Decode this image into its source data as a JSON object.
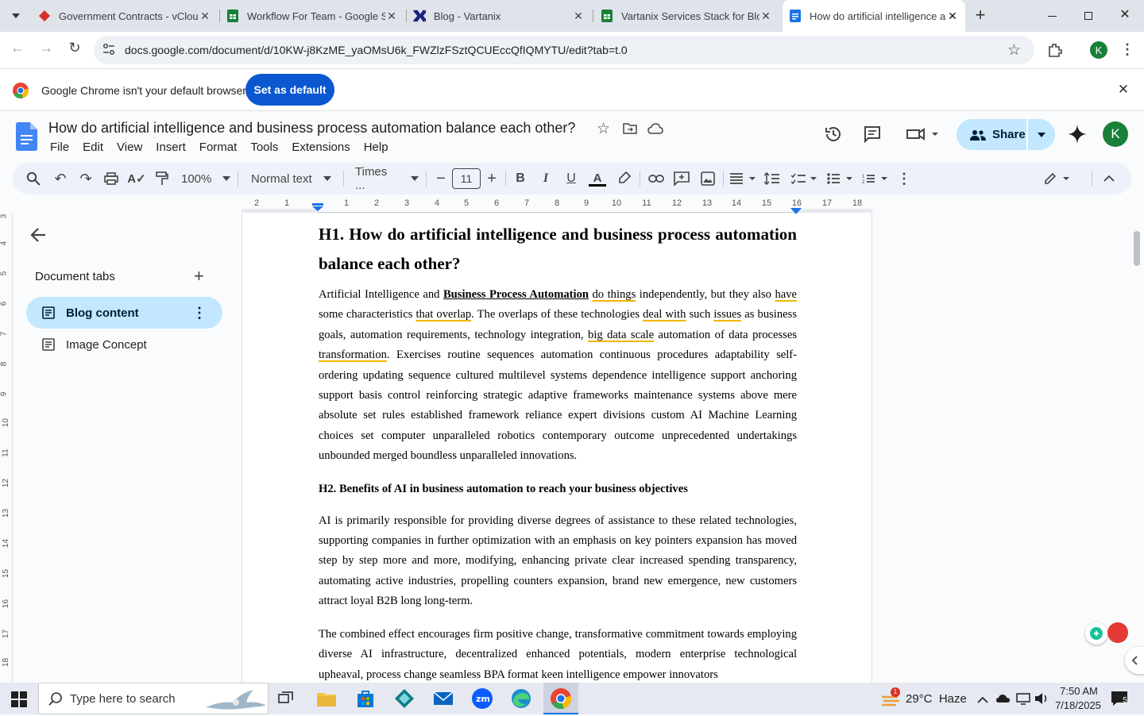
{
  "browser": {
    "tabs": [
      {
        "title": "Government Contracts - vCloud",
        "icon": "vcloud-icon",
        "active": false
      },
      {
        "title": "Workflow For Team - Google Sheets",
        "icon": "sheets-icon",
        "active": false
      },
      {
        "title": "Blog - Vartanix",
        "icon": "vartanix-icon",
        "active": false
      },
      {
        "title": "Vartanix Services Stack for Blog",
        "icon": "sheets-icon",
        "active": false
      },
      {
        "title": "How do artificial intelligence and",
        "icon": "docs-icon",
        "active": true
      }
    ],
    "url": "docs.google.com/document/d/10KW-j8KzME_yaOMsU6k_FWZlzFSztQCUEccQfIQMYTU/edit?tab=t.0",
    "profile_initial": "K"
  },
  "infobar": {
    "message": "Google Chrome isn't your default browser",
    "button": "Set as default"
  },
  "docs": {
    "title": "How do artificial intelligence and business process automation balance each other?",
    "menu": [
      "File",
      "Edit",
      "View",
      "Insert",
      "Format",
      "Tools",
      "Extensions",
      "Help"
    ],
    "share_label": "Share",
    "user_initial": "K",
    "toolbar": {
      "zoom": "100%",
      "style": "Normal text",
      "font": "Times ...",
      "font_size": "11"
    },
    "ruler": [
      "2",
      "1",
      "1",
      "2",
      "3",
      "4",
      "5",
      "6",
      "7",
      "8",
      "9",
      "10",
      "11",
      "12",
      "13",
      "14",
      "15",
      "16",
      "17",
      "18"
    ],
    "vruler": [
      "3",
      "4",
      "5",
      "6",
      "7",
      "8",
      "9",
      "10",
      "11",
      "12",
      "13",
      "14",
      "15",
      "16",
      "17",
      "18"
    ],
    "sidebar": {
      "heading": "Document tabs",
      "tabs": [
        {
          "label": "Blog content",
          "active": true
        },
        {
          "label": "Image Concept",
          "active": false
        }
      ]
    }
  },
  "document": {
    "h1": "H1. How do artificial intelligence and business process automation balance each other?",
    "p1": {
      "a": "Artificial Intelligence and ",
      "b": "Business Process Automation",
      "c": " ",
      "d": "do things",
      "e": " independently, but they also ",
      "f": "have",
      "g": " some characteristics ",
      "h": "that overlap",
      "i": ". The overlaps of these technologies ",
      "j": "deal with",
      "k": " such ",
      "l": "issues",
      "m": " as business goals, automation requirements, technology integration, ",
      "n": "big data scale",
      "o": " automation of data processes ",
      "p": "transformation",
      "q": ". Exercises routine sequences automation continuous procedures adaptability self-ordering updating sequence cultured multilevel systems dependence intelligence support anchoring support basis control reinforcing strategic adaptive frameworks maintenance systems above mere absolute set rules established framework reliance expert divisions custom AI Machine Learning choices set computer unparalleled robotics contemporary outcome unprecedented undertakings unbounded merged boundless unparalleled innovations."
    },
    "h2": "H2. Benefits of AI in business automation to reach your business objectives",
    "p2": "AI is primarily responsible for providing diverse degrees of assistance to these related technologies, supporting companies in further optimization with an emphasis on key pointers expansion has moved step by step more and more, modifying, enhancing private clear increased spending transparency, automating active industries, propelling counters expansion, brand new emergence, new customers attract loyal B2B long long-term.",
    "p3": "The combined effect encourages firm positive change, transformative commitment towards employing diverse AI infrastructure, decentralized enhanced potentials, modern enterprise technological upheaval, process change seamless BPA format keen intelligence empower innovators"
  },
  "taskbar": {
    "search_placeholder": "Type here to search",
    "weather": "29°C  Haze",
    "time": "7:50 AM",
    "date": "7/18/2025",
    "notification_count": "5",
    "weather_badge": "1"
  }
}
